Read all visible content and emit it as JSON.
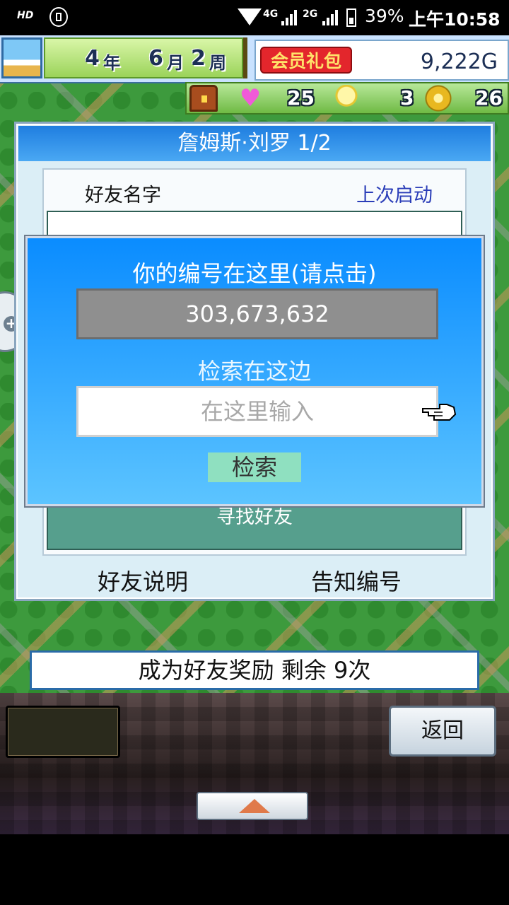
{
  "status_bar": {
    "hd": "HD",
    "network_1": "4G",
    "network_2": "2G",
    "battery": "39%",
    "time": "上午10:58"
  },
  "hud": {
    "year_num": "4",
    "year_unit": "年",
    "month_num": "6",
    "month_unit": "月",
    "week_num": "2",
    "week_unit": "周",
    "member_gift": "会员礼包",
    "gold": "9,222G",
    "hearts": "25",
    "ideas": "3",
    "coins": "26"
  },
  "dialog": {
    "title": "詹姆斯·刘罗 1/2",
    "column_name": "好友名字",
    "column_last_login": "上次启动",
    "find_friends": "寻找好友",
    "friend_help": "好友说明",
    "share_id": "告知编号"
  },
  "search_overlay": {
    "id_heading": "你的编号在这里(请点击)",
    "id_value": "303,673,632",
    "search_heading": "检索在这边",
    "search_placeholder": "在这里输入",
    "search_button": "检索"
  },
  "bottom": {
    "reward_text": "成为好友奖励 剩余 9次",
    "back_button": "返回"
  },
  "colors": {
    "overlay_top": "#0a8cff",
    "overlay_bottom": "#5cc4ff",
    "title_bar": "#1f7ee0",
    "find_button": "#569f8d",
    "search_button": "#8fe0c0",
    "member_gift": "#e3262c"
  }
}
